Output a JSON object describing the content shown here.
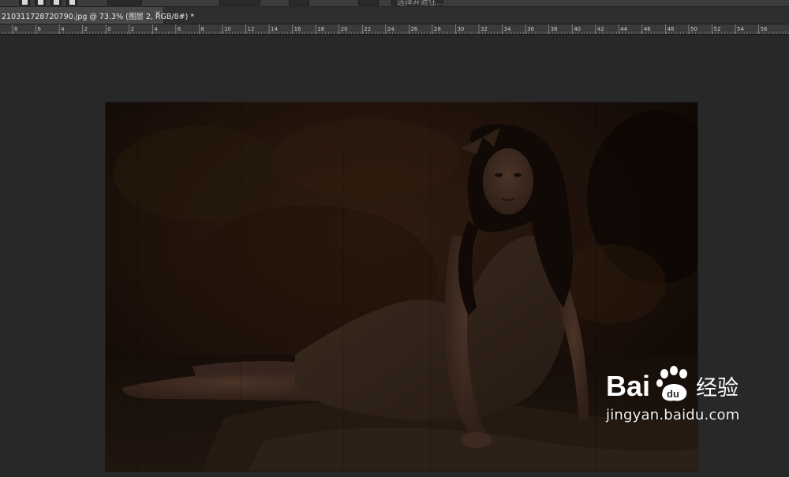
{
  "options_bar": {
    "labels": [
      "",
      "",
      "",
      ""
    ],
    "button_label": "选择并遮住..."
  },
  "document_tab": {
    "title": "210311728720790.jpg @ 73.3% (图层 2, RGB/8#) *",
    "close_glyph": "×"
  },
  "ruler": {
    "labels": [
      "8",
      "6",
      "4",
      "2",
      "0",
      "2",
      "4",
      "6",
      "8",
      "10",
      "12",
      "14",
      "16",
      "18",
      "20",
      "22",
      "24",
      "26",
      "28",
      "30",
      "32",
      "34",
      "36",
      "38",
      "40",
      "42",
      "44",
      "46",
      "48",
      "50",
      "52",
      "54",
      "56"
    ]
  },
  "watermark": {
    "logo_text_left": "Bai",
    "logo_text_right": "经验",
    "url": "jingyan.baidu.com"
  },
  "colors": {
    "workspace": "#282828",
    "image_dark": "#1b100b",
    "accent_watermark": "#ffffff"
  }
}
